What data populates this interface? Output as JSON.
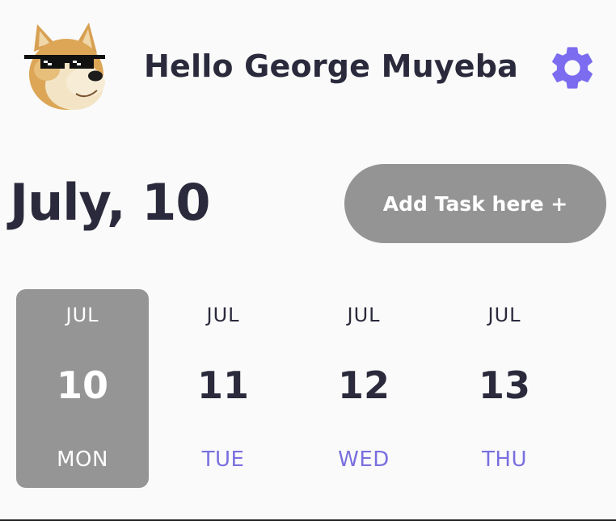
{
  "header": {
    "greeting": "Hello George Muyeba",
    "avatar_icon": "doge-with-sunglasses-avatar",
    "settings_icon": "gear-icon",
    "settings_color": "#7b6cf0"
  },
  "date_bar": {
    "current_date": "July, 10",
    "add_task_label": "Add Task here +",
    "button_color": "#949494"
  },
  "calendar": {
    "selected_color": "#959595",
    "weekday_color": "#7a6fe0",
    "days": [
      {
        "month": "JUL",
        "day": "10",
        "weekday": "MON",
        "selected": true
      },
      {
        "month": "JUL",
        "day": "11",
        "weekday": "TUE",
        "selected": false
      },
      {
        "month": "JUL",
        "day": "12",
        "weekday": "WED",
        "selected": false
      },
      {
        "month": "JUL",
        "day": "13",
        "weekday": "THU",
        "selected": false
      }
    ]
  }
}
